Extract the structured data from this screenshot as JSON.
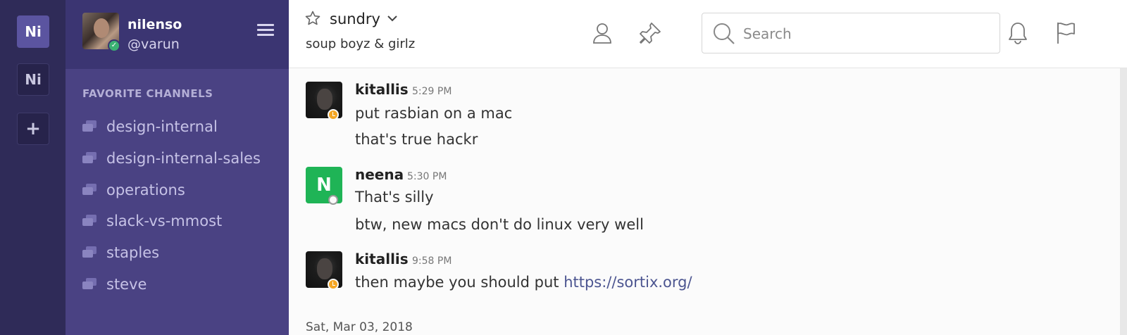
{
  "teams": {
    "active_initials": "Ni",
    "other_initials": "Ni",
    "add_label": "+"
  },
  "sidebar": {
    "team_name": "nilenso",
    "username": "@varun",
    "section_title": "FAVORITE CHANNELS",
    "channels": [
      {
        "name": "design-internal"
      },
      {
        "name": "design-internal-sales"
      },
      {
        "name": "operations"
      },
      {
        "name": "slack-vs-mmost"
      },
      {
        "name": "staples"
      },
      {
        "name": "steve"
      }
    ]
  },
  "header": {
    "channel_name": "sundry",
    "purpose": "soup boyz & girlz",
    "search_placeholder": "Search",
    "icons": [
      "star-icon",
      "chevron-down-icon",
      "member-icon",
      "pin-icon",
      "search-icon",
      "bell-icon",
      "flag-icon"
    ]
  },
  "messages": [
    {
      "author": "kitallis",
      "time": "5:29 PM",
      "status": "away",
      "lines": [
        "put rasbian on a mac",
        "that's true hackr"
      ]
    },
    {
      "author": "neena",
      "initial": "N",
      "time": "5:30 PM",
      "status": "offline",
      "lines": [
        "That's silly",
        "btw, new macs don't do linux very well"
      ]
    },
    {
      "author": "kitallis",
      "time": "9:58 PM",
      "status": "away",
      "text_prefix": "then maybe you should put ",
      "link": "https://sortix.org/"
    }
  ],
  "date_separator": "Sat, Mar 03, 2018",
  "colors": {
    "team_rail": "#2f2b58",
    "sidebar": "#4a4283",
    "sidebar_header": "#3b3572",
    "online": "#3bb273",
    "away": "#f5a623",
    "avatar_green": "#1fb456",
    "link": "#4c5590"
  }
}
